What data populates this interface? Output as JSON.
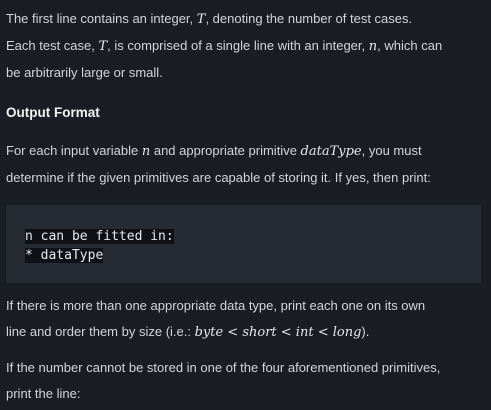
{
  "intro": {
    "line1_a": "The first line contains an integer, ",
    "line1_var": "T",
    "line1_b": ", denoting the number of test cases.",
    "line2_a": "Each test case, ",
    "line2_var": "T",
    "line2_b": ", is comprised of a single line with an integer, ",
    "line2_var2": "n",
    "line2_c": ", which can",
    "line3": "be arbitrarily large or small."
  },
  "output_heading": "Output Format",
  "output_desc": {
    "line1_a": "For each input variable ",
    "line1_var": "n",
    "line1_b": " and appropriate primitive ",
    "line1_var2": "dataType",
    "line1_c": ", you must",
    "line2": "determine if the given primitives are capable of storing it. If yes, then print:"
  },
  "code_block": {
    "line1": "n can be fitted in:",
    "line2": "* dataType"
  },
  "order_note": {
    "line1": "If there is more than one appropriate data type, print each one on its own",
    "line2_a": "line and order them by size (i.e.: ",
    "line2_math": "byte < short < int < long",
    "line2_b": ")."
  },
  "fail_note": {
    "line1": "If the number cannot be stored in one of the four aforementioned primitives,",
    "line2": "print the line:"
  }
}
